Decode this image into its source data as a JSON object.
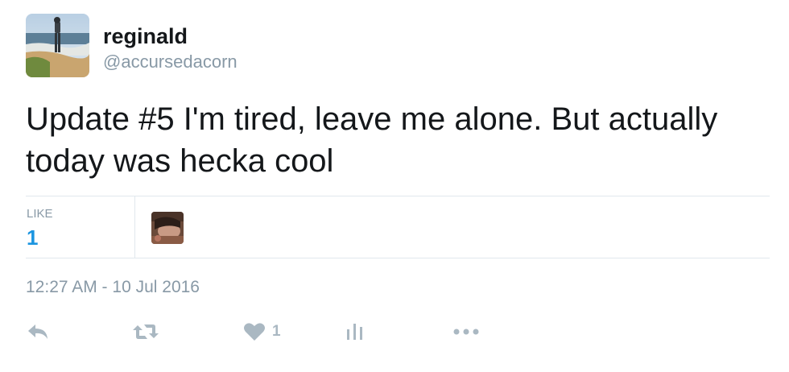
{
  "tweet": {
    "author": {
      "display_name": "reginald",
      "handle": "@accursedacorn"
    },
    "text": "Update #5 I'm tired, leave me alone. But actually today was hecka cool",
    "stats": {
      "likes_label": "LIKE",
      "likes_count": "1"
    },
    "timestamp": "12:27 AM - 10 Jul 2016",
    "actions": {
      "like_count": "1",
      "icons": [
        "reply-icon",
        "retweet-icon",
        "heart-icon",
        "analytics-icon",
        "more-icon"
      ]
    }
  },
  "colors": {
    "text": "#14171a",
    "secondary": "#8899a6",
    "accent": "#1b95e0",
    "icon": "#aab8c2",
    "divider": "#e1e8ed"
  }
}
